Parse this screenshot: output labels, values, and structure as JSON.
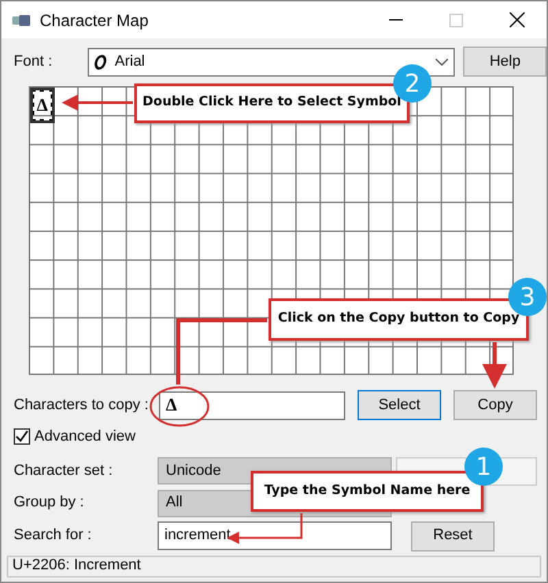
{
  "window": {
    "title": "Character Map"
  },
  "font": {
    "label": "Font :",
    "value": "Arial",
    "button": "Help"
  },
  "grid": {
    "cells": [
      {
        "glyph": "Δ",
        "selected": true
      }
    ]
  },
  "copy_row": {
    "label": "Characters to copy :",
    "value": "Δ",
    "select_button": "Select",
    "copy_button": "Copy"
  },
  "advanced_view": {
    "label": "Advanced view",
    "checked": true
  },
  "character_set": {
    "label": "Character set :",
    "value": "Unicode"
  },
  "group_by": {
    "label": "Group by :",
    "value": "All"
  },
  "search": {
    "label": "Search for :",
    "value": "increment",
    "button": "Reset"
  },
  "status_bar": "U+2206: Increment",
  "callouts": [
    {
      "number": "2",
      "text": "Double Click Here to Select Symbol"
    },
    {
      "number": "3",
      "text": "Click on the Copy button to Copy"
    },
    {
      "number": "1",
      "text": "Type the Symbol Name here"
    }
  ]
}
